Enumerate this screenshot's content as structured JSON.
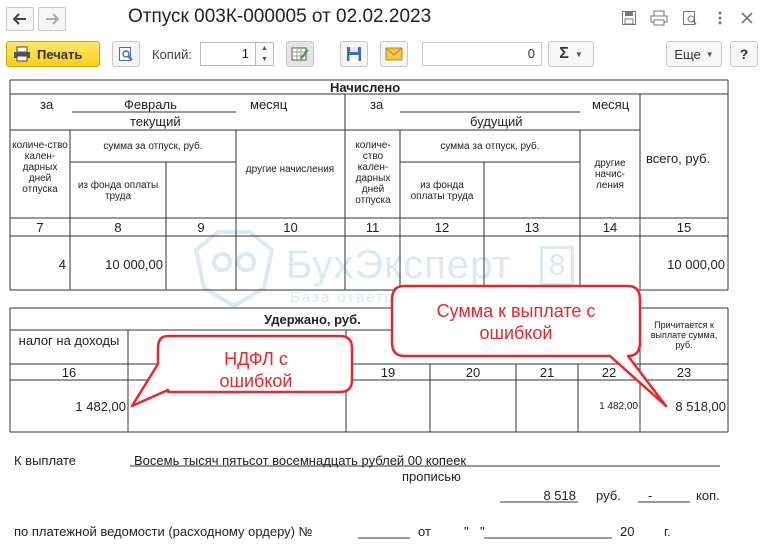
{
  "window": {
    "title": "Отпуск 003К-000005 от 02.02.2023"
  },
  "toolbar": {
    "print_label": "Печать",
    "copies_label": "Копий:",
    "copies_value": "1",
    "sum_value": "0",
    "sigma_label": "Σ",
    "more_label": "Еще",
    "help_label": "?"
  },
  "sections": {
    "accrued": "Начислено",
    "withheld": "Удержано, руб."
  },
  "period_row": {
    "za1": "за",
    "month1": "Февраль",
    "mesyats1": "месяц",
    "sub1": "текущий",
    "za2": "за",
    "mesyats2": "месяц",
    "sub2": "будущий"
  },
  "col_headers": {
    "days1": "количе-ство кален-дарных дней отпуска",
    "vacsum1": "сумма за отпуск, руб.",
    "fund1": "из фонда оплаты труда",
    "other1": "другие начисления",
    "days2": "количе-ство кален-дарных дней отпуска",
    "vacsum2": "сумма за отпуск, руб.",
    "fund2": "из фонда оплаты труда",
    "other2": "другие начис-ления",
    "total": "всего, руб."
  },
  "col_numbers_top": [
    "7",
    "8",
    "9",
    "10",
    "11",
    "12",
    "13",
    "14",
    "15"
  ],
  "values_top": {
    "c7": "4",
    "c8": "10 000,00",
    "c15": "10 000,00"
  },
  "withheld_headers": {
    "tax": "налог на доходы",
    "payable": "Причитается к выплате сумма, руб."
  },
  "col_numbers_bottom": [
    "16",
    "19",
    "20",
    "21",
    "22",
    "23"
  ],
  "values_bottom": {
    "c16": "1 482,00",
    "c22": "1 482,00",
    "c23": "8 518,00"
  },
  "footer": {
    "k_vyplate": "К выплате",
    "amount_words": "Восемь тысяч пятьсот восемнадцать рублей 00 копеек",
    "propisyu": "прописью",
    "amount_num": "8 518",
    "rub": "руб.",
    "kop_dash": "-",
    "kop": "коп.",
    "statement": "по платежной ведомости (расходному ордеру) №",
    "ot": "от",
    "q1": "\"",
    "q2": "\"",
    "year": "20",
    "g": "г."
  },
  "watermark": {
    "name": "БухЭксперт",
    "digit": "8",
    "tagline": "База ответов по учету в 1С"
  },
  "callouts": {
    "ndfl_line1": "НДФЛ с",
    "ndfl_line2": "ошибкой",
    "pay_line1": "Сумма к выплате с",
    "pay_line2": "ошибкой"
  },
  "colors": {
    "callout_red": "#e8262b",
    "print_yellow": "#f5cf1d",
    "watermark_blue": "#dce8f3"
  }
}
